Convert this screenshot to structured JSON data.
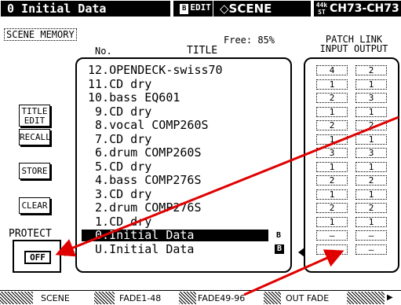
{
  "header": {
    "title": "0 Initial Data",
    "edit_badge_b": "B",
    "edit_label": "EDIT",
    "scene_label": "SCENE",
    "rate_top": "44k",
    "rate_bottom": "ST",
    "channel": "CH73-CH73"
  },
  "section_label": "SCENE MEMORY",
  "free_label": "Free: 85%",
  "columns": {
    "no": "No.",
    "title": "TITLE"
  },
  "patch_link": {
    "heading": "PATCH LINK",
    "input": "INPUT",
    "output": "OUTPUT"
  },
  "buttons": {
    "title_edit_1": "TITLE",
    "title_edit_2": "EDIT",
    "recall": "RECALL",
    "store": "STORE",
    "clear": "CLEAR",
    "protect": "PROTECT",
    "off": "OFF"
  },
  "scenes": [
    {
      "label": "12.OPENDECK-swiss70",
      "badge": ""
    },
    {
      "label": "11.CD dry",
      "badge": ""
    },
    {
      "label": "10.bass EQ601",
      "badge": ""
    },
    {
      "label": " 9.CD dry",
      "badge": ""
    },
    {
      "label": " 8.vocal COMP260S",
      "badge": ""
    },
    {
      "label": " 7.CD dry",
      "badge": ""
    },
    {
      "label": " 6.drum COMP260S",
      "badge": ""
    },
    {
      "label": " 5.CD dry",
      "badge": ""
    },
    {
      "label": " 4.bass COMP276S",
      "badge": ""
    },
    {
      "label": " 3.CD dry",
      "badge": ""
    },
    {
      "label": " 2.drum COMP276S",
      "badge": ""
    },
    {
      "label": " 1.CD dry",
      "badge": ""
    },
    {
      "label": " 0.Initial Data",
      "badge": "B",
      "selected": true
    },
    {
      "label": " U.Initial Data",
      "badge": "B"
    }
  ],
  "patch_values": [
    [
      "4",
      "2"
    ],
    [
      "1",
      "1"
    ],
    [
      "2",
      "3"
    ],
    [
      "1",
      "1"
    ],
    [
      "2",
      "2"
    ],
    [
      "1",
      "1"
    ],
    [
      "3",
      "3"
    ],
    [
      "1",
      "1"
    ],
    [
      "2",
      "2"
    ],
    [
      "1",
      "1"
    ],
    [
      "2",
      "2"
    ],
    [
      "1",
      "1"
    ],
    [
      "–",
      "–"
    ],
    [
      "–",
      "–"
    ]
  ],
  "tabs": [
    "SCENE",
    "FADE1-48",
    "FADE49-96",
    "OUT FADE"
  ],
  "tab_arrow": "▶",
  "colors": {
    "annotation": "#e00000",
    "selection": "#000000"
  }
}
